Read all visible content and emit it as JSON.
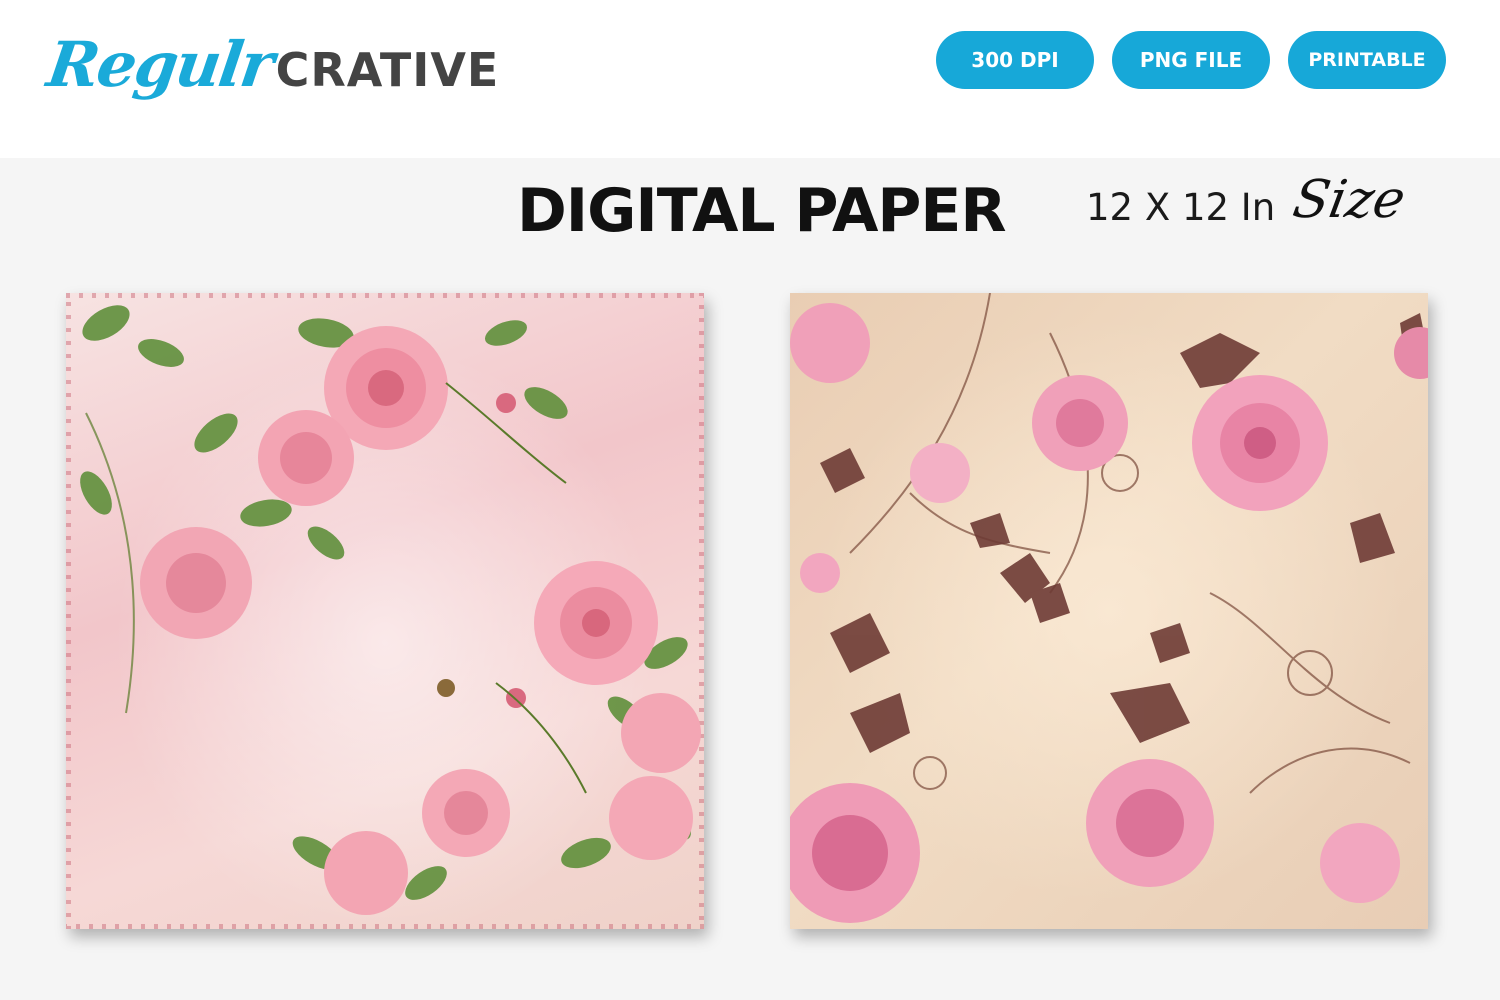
{
  "brand": {
    "script_part": "Regulr",
    "bold_part": "CRATIVE",
    "colors": {
      "script": "#1aaad9",
      "bold": "#444444"
    }
  },
  "badges": [
    {
      "label": "300 DPI"
    },
    {
      "label": "PNG FILE"
    },
    {
      "label": "PRINTABLE"
    }
  ],
  "accent_color": "#17a8d8",
  "headline": "DIGITAL PAPER",
  "size": {
    "dimensions": "12 X 12 In",
    "script_word": "Size"
  },
  "papers": [
    {
      "style": "pink shabby-chic roses with green leaves",
      "base_colors": [
        "#f2c6ca",
        "#f7e3e2"
      ]
    },
    {
      "style": "cream parchment with pink peonies, brown leaves and swirls",
      "base_colors": [
        "#e9cdb3",
        "#f1dcc4"
      ]
    }
  ]
}
